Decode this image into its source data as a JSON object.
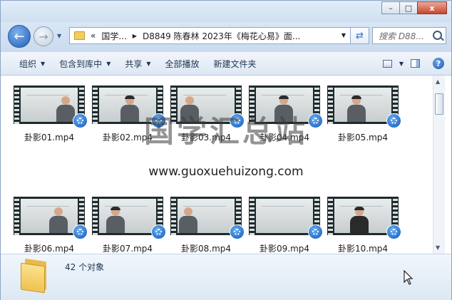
{
  "window": {
    "caption_buttons": {
      "minimize": "–",
      "maximize": "□",
      "close": "x"
    }
  },
  "address_bar": {
    "overflow": "«",
    "crumbs": [
      "国学...",
      "D8849 陈春林 2023年《梅花心易》面..."
    ],
    "search_placeholder": "搜索 D88..."
  },
  "toolbar": {
    "items": [
      "组织",
      "包含到库中",
      "共享",
      "全部播放",
      "新建文件夹"
    ]
  },
  "files": [
    {
      "name": "卦影01.mp4"
    },
    {
      "name": "卦影02.mp4"
    },
    {
      "name": "卦影03.mp4"
    },
    {
      "name": "卦影04.mp4"
    },
    {
      "name": "卦影05.mp4"
    },
    {
      "name": "卦影06.mp4"
    },
    {
      "name": "卦影07.mp4"
    },
    {
      "name": "卦影08.mp4"
    },
    {
      "name": "卦影09.mp4"
    },
    {
      "name": "卦影10.mp4"
    }
  ],
  "watermark": {
    "title": "国学汇总站",
    "url": "www.guoxuehuizong.com"
  },
  "status": {
    "count_text": "42 个对象"
  },
  "colors": {
    "accent": "#1d5db7",
    "command_text": "#1e3555",
    "folder": "#f0c24f"
  }
}
